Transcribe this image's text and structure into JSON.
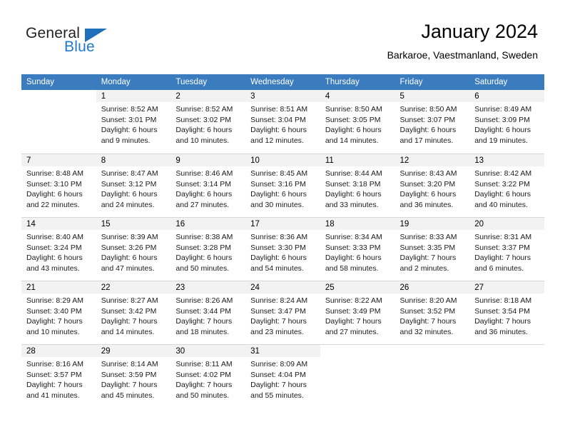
{
  "brand": {
    "name_part1": "General",
    "name_part2": "Blue",
    "logo_color": "#1f6fba"
  },
  "header": {
    "title": "January 2024",
    "subtitle": "Barkaroe, Vaestmanland, Sweden"
  },
  "theme": {
    "header_row_bg": "#3a7cbe",
    "daynum_bg": "#f2f2f2",
    "grid_line": "#d8d8d8"
  },
  "weekday_headers": [
    "Sunday",
    "Monday",
    "Tuesday",
    "Wednesday",
    "Thursday",
    "Friday",
    "Saturday"
  ],
  "weeks": [
    [
      {
        "day": "",
        "sunrise": "",
        "sunset": "",
        "daylight_line1": "",
        "daylight_line2": ""
      },
      {
        "day": "1",
        "sunrise": "Sunrise: 8:52 AM",
        "sunset": "Sunset: 3:01 PM",
        "daylight_line1": "Daylight: 6 hours",
        "daylight_line2": "and 9 minutes."
      },
      {
        "day": "2",
        "sunrise": "Sunrise: 8:52 AM",
        "sunset": "Sunset: 3:02 PM",
        "daylight_line1": "Daylight: 6 hours",
        "daylight_line2": "and 10 minutes."
      },
      {
        "day": "3",
        "sunrise": "Sunrise: 8:51 AM",
        "sunset": "Sunset: 3:04 PM",
        "daylight_line1": "Daylight: 6 hours",
        "daylight_line2": "and 12 minutes."
      },
      {
        "day": "4",
        "sunrise": "Sunrise: 8:50 AM",
        "sunset": "Sunset: 3:05 PM",
        "daylight_line1": "Daylight: 6 hours",
        "daylight_line2": "and 14 minutes."
      },
      {
        "day": "5",
        "sunrise": "Sunrise: 8:50 AM",
        "sunset": "Sunset: 3:07 PM",
        "daylight_line1": "Daylight: 6 hours",
        "daylight_line2": "and 17 minutes."
      },
      {
        "day": "6",
        "sunrise": "Sunrise: 8:49 AM",
        "sunset": "Sunset: 3:09 PM",
        "daylight_line1": "Daylight: 6 hours",
        "daylight_line2": "and 19 minutes."
      }
    ],
    [
      {
        "day": "7",
        "sunrise": "Sunrise: 8:48 AM",
        "sunset": "Sunset: 3:10 PM",
        "daylight_line1": "Daylight: 6 hours",
        "daylight_line2": "and 22 minutes."
      },
      {
        "day": "8",
        "sunrise": "Sunrise: 8:47 AM",
        "sunset": "Sunset: 3:12 PM",
        "daylight_line1": "Daylight: 6 hours",
        "daylight_line2": "and 24 minutes."
      },
      {
        "day": "9",
        "sunrise": "Sunrise: 8:46 AM",
        "sunset": "Sunset: 3:14 PM",
        "daylight_line1": "Daylight: 6 hours",
        "daylight_line2": "and 27 minutes."
      },
      {
        "day": "10",
        "sunrise": "Sunrise: 8:45 AM",
        "sunset": "Sunset: 3:16 PM",
        "daylight_line1": "Daylight: 6 hours",
        "daylight_line2": "and 30 minutes."
      },
      {
        "day": "11",
        "sunrise": "Sunrise: 8:44 AM",
        "sunset": "Sunset: 3:18 PM",
        "daylight_line1": "Daylight: 6 hours",
        "daylight_line2": "and 33 minutes."
      },
      {
        "day": "12",
        "sunrise": "Sunrise: 8:43 AM",
        "sunset": "Sunset: 3:20 PM",
        "daylight_line1": "Daylight: 6 hours",
        "daylight_line2": "and 36 minutes."
      },
      {
        "day": "13",
        "sunrise": "Sunrise: 8:42 AM",
        "sunset": "Sunset: 3:22 PM",
        "daylight_line1": "Daylight: 6 hours",
        "daylight_line2": "and 40 minutes."
      }
    ],
    [
      {
        "day": "14",
        "sunrise": "Sunrise: 8:40 AM",
        "sunset": "Sunset: 3:24 PM",
        "daylight_line1": "Daylight: 6 hours",
        "daylight_line2": "and 43 minutes."
      },
      {
        "day": "15",
        "sunrise": "Sunrise: 8:39 AM",
        "sunset": "Sunset: 3:26 PM",
        "daylight_line1": "Daylight: 6 hours",
        "daylight_line2": "and 47 minutes."
      },
      {
        "day": "16",
        "sunrise": "Sunrise: 8:38 AM",
        "sunset": "Sunset: 3:28 PM",
        "daylight_line1": "Daylight: 6 hours",
        "daylight_line2": "and 50 minutes."
      },
      {
        "day": "17",
        "sunrise": "Sunrise: 8:36 AM",
        "sunset": "Sunset: 3:30 PM",
        "daylight_line1": "Daylight: 6 hours",
        "daylight_line2": "and 54 minutes."
      },
      {
        "day": "18",
        "sunrise": "Sunrise: 8:34 AM",
        "sunset": "Sunset: 3:33 PM",
        "daylight_line1": "Daylight: 6 hours",
        "daylight_line2": "and 58 minutes."
      },
      {
        "day": "19",
        "sunrise": "Sunrise: 8:33 AM",
        "sunset": "Sunset: 3:35 PM",
        "daylight_line1": "Daylight: 7 hours",
        "daylight_line2": "and 2 minutes."
      },
      {
        "day": "20",
        "sunrise": "Sunrise: 8:31 AM",
        "sunset": "Sunset: 3:37 PM",
        "daylight_line1": "Daylight: 7 hours",
        "daylight_line2": "and 6 minutes."
      }
    ],
    [
      {
        "day": "21",
        "sunrise": "Sunrise: 8:29 AM",
        "sunset": "Sunset: 3:40 PM",
        "daylight_line1": "Daylight: 7 hours",
        "daylight_line2": "and 10 minutes."
      },
      {
        "day": "22",
        "sunrise": "Sunrise: 8:27 AM",
        "sunset": "Sunset: 3:42 PM",
        "daylight_line1": "Daylight: 7 hours",
        "daylight_line2": "and 14 minutes."
      },
      {
        "day": "23",
        "sunrise": "Sunrise: 8:26 AM",
        "sunset": "Sunset: 3:44 PM",
        "daylight_line1": "Daylight: 7 hours",
        "daylight_line2": "and 18 minutes."
      },
      {
        "day": "24",
        "sunrise": "Sunrise: 8:24 AM",
        "sunset": "Sunset: 3:47 PM",
        "daylight_line1": "Daylight: 7 hours",
        "daylight_line2": "and 23 minutes."
      },
      {
        "day": "25",
        "sunrise": "Sunrise: 8:22 AM",
        "sunset": "Sunset: 3:49 PM",
        "daylight_line1": "Daylight: 7 hours",
        "daylight_line2": "and 27 minutes."
      },
      {
        "day": "26",
        "sunrise": "Sunrise: 8:20 AM",
        "sunset": "Sunset: 3:52 PM",
        "daylight_line1": "Daylight: 7 hours",
        "daylight_line2": "and 32 minutes."
      },
      {
        "day": "27",
        "sunrise": "Sunrise: 8:18 AM",
        "sunset": "Sunset: 3:54 PM",
        "daylight_line1": "Daylight: 7 hours",
        "daylight_line2": "and 36 minutes."
      }
    ],
    [
      {
        "day": "28",
        "sunrise": "Sunrise: 8:16 AM",
        "sunset": "Sunset: 3:57 PM",
        "daylight_line1": "Daylight: 7 hours",
        "daylight_line2": "and 41 minutes."
      },
      {
        "day": "29",
        "sunrise": "Sunrise: 8:14 AM",
        "sunset": "Sunset: 3:59 PM",
        "daylight_line1": "Daylight: 7 hours",
        "daylight_line2": "and 45 minutes."
      },
      {
        "day": "30",
        "sunrise": "Sunrise: 8:11 AM",
        "sunset": "Sunset: 4:02 PM",
        "daylight_line1": "Daylight: 7 hours",
        "daylight_line2": "and 50 minutes."
      },
      {
        "day": "31",
        "sunrise": "Sunrise: 8:09 AM",
        "sunset": "Sunset: 4:04 PM",
        "daylight_line1": "Daylight: 7 hours",
        "daylight_line2": "and 55 minutes."
      },
      {
        "day": "",
        "sunrise": "",
        "sunset": "",
        "daylight_line1": "",
        "daylight_line2": ""
      },
      {
        "day": "",
        "sunrise": "",
        "sunset": "",
        "daylight_line1": "",
        "daylight_line2": ""
      },
      {
        "day": "",
        "sunrise": "",
        "sunset": "",
        "daylight_line1": "",
        "daylight_line2": ""
      }
    ]
  ]
}
